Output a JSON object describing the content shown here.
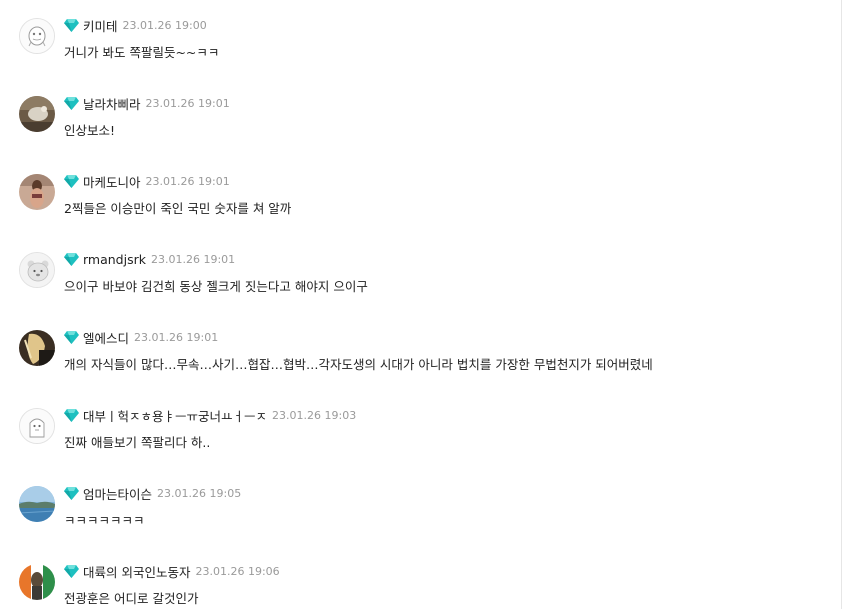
{
  "colors": {
    "gem": "#1ec0c0",
    "nickname": "#222222",
    "timestamp": "#9a9a9a",
    "body_text": "#222222"
  },
  "comments": [
    {
      "nickname": "키미테",
      "timestamp": "23.01.26 19:00",
      "text": "거니가 봐도 쪽팔릴듯~~ㅋㅋ",
      "badge_icon": "diamond-icon",
      "avatar": "default-character-avatar"
    },
    {
      "nickname": "날라차삐라",
      "timestamp": "23.01.26 19:01",
      "text": "인상보소!",
      "badge_icon": "diamond-icon",
      "avatar": "photo-avatar"
    },
    {
      "nickname": "마케도니아",
      "timestamp": "23.01.26 19:01",
      "text": "2찍들은 이승만이 죽인 국민 숫자를 쳐 알까",
      "badge_icon": "diamond-icon",
      "avatar": "photo-avatar"
    },
    {
      "nickname": "rmandjsrk",
      "timestamp": "23.01.26 19:01",
      "text": "으이구 바보야 김건희 동상 젤크게 짓는다고 해야지 으이구",
      "badge_icon": "diamond-icon",
      "avatar": "bear-avatar"
    },
    {
      "nickname": "엘에스디",
      "timestamp": "23.01.26 19:01",
      "text": "개의 자식들이 많다…무속…사기…협잡…협박…각자도생의 시대가 아니라 법치를 가장한 무법천지가 되어버렸네",
      "badge_icon": "diamond-icon",
      "avatar": "photo-avatar"
    },
    {
      "nickname": "대부ㅣ헉ㅈㅎ용ㅑㅡㅠ궁너ㅛㅓㅡㅈ",
      "timestamp": "23.01.26 19:03",
      "text": "진짜 애들보기 쪽팔리다 하..",
      "badge_icon": "diamond-icon",
      "avatar": "default-character-avatar"
    },
    {
      "nickname": "엄마는타이슨",
      "timestamp": "23.01.26 19:05",
      "text": "ㅋㅋㅋㅋㅋㅋㅋ",
      "badge_icon": "diamond-icon",
      "avatar": "landscape-avatar"
    },
    {
      "nickname": "대륙의 외국인노동자",
      "timestamp": "23.01.26 19:06",
      "text": "전광훈은 어디로 갈것인가",
      "badge_icon": "diamond-icon",
      "avatar": "photo-avatar"
    }
  ]
}
